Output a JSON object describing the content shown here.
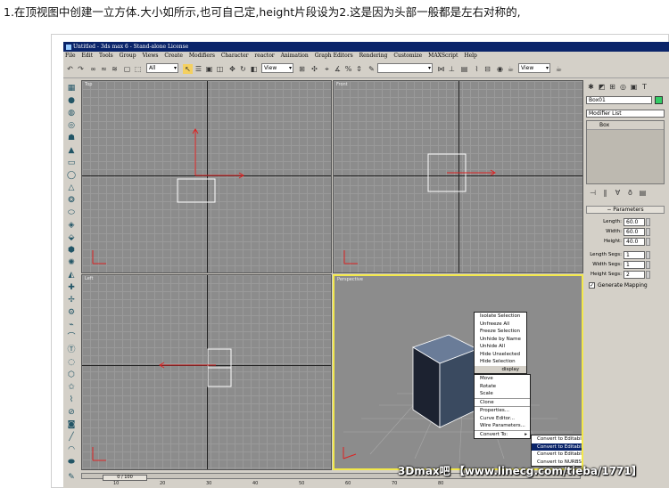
{
  "caption": "1.在顶视图中创建一立方体.大小如所示,也可自己定,height片段设为2.这是因为头部一般都是左右对称的,",
  "window": {
    "title": "Untitled - 3ds max 6 - Stand-alone License"
  },
  "menu": [
    "File",
    "Edit",
    "Tools",
    "Group",
    "Views",
    "Create",
    "Modifiers",
    "Character",
    "reactor",
    "Animation",
    "Graph Editors",
    "Rendering",
    "Customize",
    "MAXScript",
    "Help"
  ],
  "toolbar": {
    "filter": "All",
    "refcoord": "View",
    "named_sel": "",
    "view2": "View"
  },
  "viewports": {
    "top": "Top",
    "front": "Front",
    "left": "Left",
    "persp": "Perspective"
  },
  "panel": {
    "object_name": "Box01",
    "modifier_list": "Modifier List",
    "stack_item": "Box",
    "rollout_title": "Parameters",
    "length_label": "Length:",
    "length_value": "60.0",
    "width_label": "Width:",
    "width_value": "60.0",
    "height_label": "Height:",
    "height_value": "40.0",
    "lsegs_label": "Length Segs:",
    "lsegs_value": "1",
    "wsegs_label": "Width Segs:",
    "wsegs_value": "1",
    "hsegs_label": "Height Segs:",
    "hsegs_value": "2",
    "genmap_label": "Generate Mapping"
  },
  "quad_menu": {
    "display": [
      "Isolate Selection",
      "Unfreeze All",
      "Freeze Selection",
      "Unhide by Name",
      "Unhide All",
      "Hide Unselected",
      "Hide Selection"
    ],
    "display_title": "display",
    "transform": [
      "Move",
      "Rotate",
      "Scale"
    ],
    "clone": "Clone",
    "props": [
      "Properties...",
      "Curve Editor...",
      "Wire Parameters..."
    ],
    "convert": "Convert To:",
    "convert_sub": [
      "Convert to Editable Mesh",
      "Convert to Editable Poly",
      "Convert to Editable Patch",
      "Convert to NURBS"
    ]
  },
  "status": {
    "time": "0 / 100",
    "ticks": [
      "10",
      "20",
      "30",
      "40",
      "50",
      "60",
      "70",
      "80"
    ]
  },
  "watermark": "3Dmax吧 【www.linecg.com/tieba/1771】",
  "colors": {
    "title_bg": "#0a246a",
    "ui_bg": "#d4d0c8",
    "viewport_bg": "#8c8c8c",
    "active_vp": "#f2e84a",
    "axis_red": "#d22"
  }
}
